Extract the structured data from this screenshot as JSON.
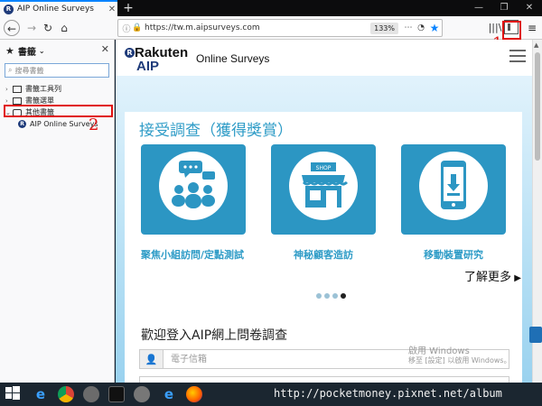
{
  "browser": {
    "tab_title": "AIP Online Surveys",
    "url": "https://tw.m.aipsurveys.com",
    "zoom": "133%",
    "accent": "#0a84ff"
  },
  "sidebar": {
    "header": "書籤",
    "search_placeholder": "搜尋書籤",
    "items": [
      {
        "label": "書籤工具列",
        "icon": "toolbar-folder-icon"
      },
      {
        "label": "書籤選單",
        "icon": "menu-folder-icon"
      },
      {
        "label": "其他書籤",
        "icon": "folder-icon"
      }
    ],
    "child": {
      "label": "AIP Online Surveys"
    }
  },
  "annotations": {
    "marker_1": "1",
    "marker_2": "2",
    "color": "#e01010"
  },
  "site": {
    "brand": "Rakuten",
    "aip": "AIP",
    "subtitle": "Online Surveys",
    "banner_title": "接受調查（獲得獎賞）",
    "features": [
      {
        "label": "聚焦小組訪問/定點測試",
        "icon": "group-chat-icon"
      },
      {
        "label": "神秘顧客造訪",
        "icon": "shop-icon"
      },
      {
        "label": "移動裝置研究",
        "icon": "mobile-download-icon"
      }
    ],
    "shop_sign": "SHOP",
    "more_link": "了解更多",
    "login_title": "歡迎登入AIP網上問卷調查",
    "email_placeholder": "電子信箱",
    "brand_color": "#2c96c3"
  },
  "os": {
    "activation_line1": "啟用 Windows",
    "activation_line2": "移至 [設定] 以啟用 Windows。",
    "watermark": "http://pocketmoney.pixnet.net/album"
  }
}
